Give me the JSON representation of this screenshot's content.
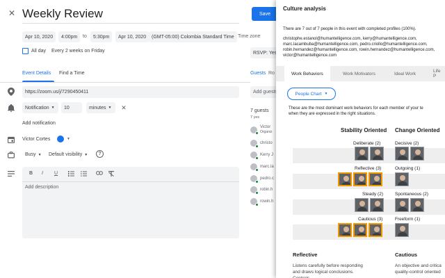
{
  "event": {
    "title": "Weekly Review",
    "start_date": "Apr 10, 2020",
    "start_time": "4:00pm",
    "to": "to",
    "end_time": "5:30pm",
    "end_date": "Apr 10, 2020",
    "timezone": "(GMT-05:00) Colombia Standard Time",
    "timezone_link": "Time zone",
    "all_day": "All day",
    "recurrence": "Every 2 weeks on Friday",
    "save": "Save"
  },
  "tabs": {
    "event_details": "Event Details",
    "find_time": "Find a Time"
  },
  "location": "https://zoom.us/j/7290450411",
  "notification": {
    "type": "Notification",
    "value": "10",
    "unit": "minutes",
    "add": "Add notification"
  },
  "calendar": {
    "owner": "Victor Cortes",
    "color": "#1a73e8"
  },
  "status": {
    "busy": "Busy",
    "visibility": "Default visibility"
  },
  "description": {
    "placeholder": "Add description",
    "toolbar": [
      "B",
      "I",
      "U"
    ]
  },
  "rsvp": "RSVP: Yes",
  "guests": {
    "tab": "Guests",
    "tab2": "Ro",
    "add_placeholder": "Add guests",
    "count": "7 guests",
    "yes": "7 yes",
    "list": [
      {
        "name": "Victor",
        "sub": "Organiz"
      },
      {
        "name": "christo",
        "sub": ""
      },
      {
        "name": "Kerry J",
        "sub": ""
      },
      {
        "name": "marc.la",
        "sub": ""
      },
      {
        "name": "pedro.c",
        "sub": ""
      },
      {
        "name": "robin.h",
        "sub": ""
      },
      {
        "name": "rowin.h",
        "sub": ""
      }
    ]
  },
  "panel": {
    "title": "Culture analysis",
    "summary": "There are 7 out of 7 people in this event with completed profiles (100%).",
    "emails": [
      "christophe.estanol@humantelligence.com, kerry@humantelligence.com,",
      "marc.lacambuba@humantelligence.com, pedro.criollo@humantelligence.com,",
      "robin.hernandez@humantelligence.com, rowin.hernandez@humantelligence.com,",
      "victor@humantelligence.com"
    ],
    "tabs": [
      "Work Behaviors",
      "Work Motivators",
      "Ideal Work",
      "Life P"
    ],
    "people_chart": "People Chart",
    "intro": [
      "These are the most dominant work behaviors for each member of your te",
      "when they are expressed in the right situations."
    ],
    "col1": "Stability Oriented",
    "col2": "Change Oriented",
    "left": [
      {
        "label": "Deliberate (2)"
      },
      {
        "label": "Reflective (3)"
      },
      {
        "label": "Steady (2)"
      },
      {
        "label": "Cautious (3)"
      }
    ],
    "right": [
      {
        "label": "Decisive (2)"
      },
      {
        "label": "Outgoing (1)"
      },
      {
        "label": "Spontaneous (2)"
      },
      {
        "label": "Freeform (1)"
      }
    ],
    "desc1_title": "Reflective",
    "desc1_text": "Listens carefully before responding and draws logical conclusions. Controls",
    "desc2_title": "Cautious",
    "desc2_text": "An objective and critica quality-control oriented"
  }
}
